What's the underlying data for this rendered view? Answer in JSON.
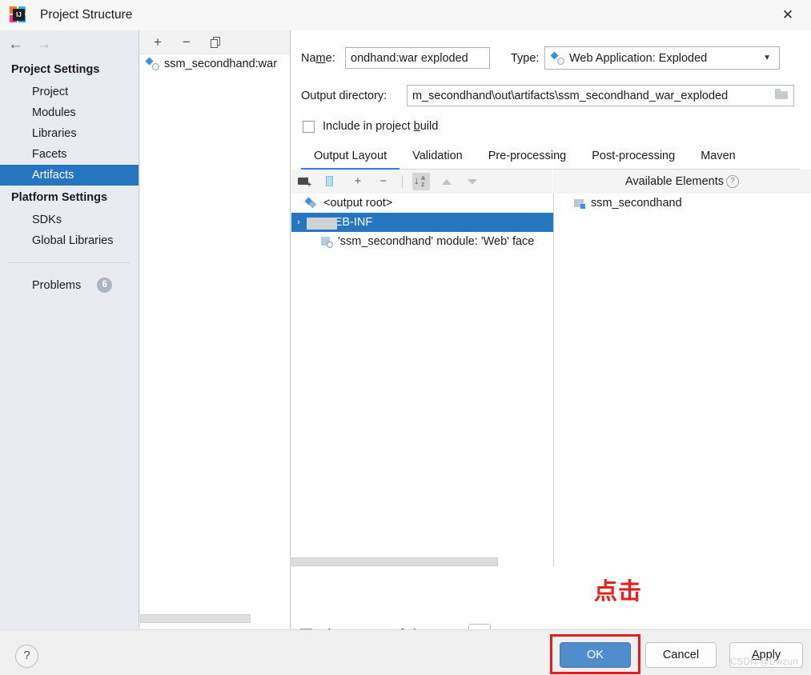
{
  "window": {
    "title": "Project Structure",
    "close_label": "✕",
    "logo_text": "IJ"
  },
  "nav": {
    "back_icon": "←",
    "forward_icon": "→"
  },
  "sidebar": {
    "sections": [
      {
        "label": "Project Settings",
        "items": [
          {
            "label": "Project",
            "selected": false
          },
          {
            "label": "Modules",
            "selected": false
          },
          {
            "label": "Libraries",
            "selected": false
          },
          {
            "label": "Facets",
            "selected": false
          },
          {
            "label": "Artifacts",
            "selected": true
          }
        ]
      },
      {
        "label": "Platform Settings",
        "items": [
          {
            "label": "SDKs",
            "selected": false
          },
          {
            "label": "Global Libraries",
            "selected": false
          }
        ]
      }
    ],
    "problems": {
      "label": "Problems",
      "count": "6"
    }
  },
  "artifact_panel": {
    "toolbar": {
      "add_label": "+",
      "remove_label": "−",
      "copy_label": "copy-icon"
    },
    "items": [
      {
        "label": "ssm_secondhand:war"
      }
    ]
  },
  "detail": {
    "name_label": "Name:",
    "name_value": "ondhand:war exploded",
    "type_label": "Type:",
    "type_value": "Web Application: Exploded",
    "type_caret": "▼",
    "output_label": "Output directory:",
    "output_value": "m_secondhand\\out\\artifacts\\ssm_secondhand_war_exploded",
    "include_label_pre": "Include in project ",
    "include_label_underlined": "b",
    "include_label_post": "uild",
    "include_checked": false,
    "tabs": [
      {
        "label": "Output Layout",
        "active": true
      },
      {
        "label": "Validation",
        "active": false
      },
      {
        "label": "Pre-processing",
        "active": false
      },
      {
        "label": "Post-processing",
        "active": false
      },
      {
        "label": "Maven",
        "active": false
      }
    ]
  },
  "layout_toolbar": {
    "add_folder_icon": "add-folder-icon",
    "add_archive_icon": "add-archive-icon",
    "add_icon": "+",
    "remove_icon": "−",
    "sort_icon": "sort-az-icon",
    "move_up_icon": "▲",
    "move_down_icon": "▼"
  },
  "available_elements": {
    "header": "Available Elements",
    "help_glyph": "?",
    "items": [
      {
        "label": "ssm_secondhand"
      }
    ]
  },
  "output_tree": {
    "rows": [
      {
        "label": "<output root>",
        "icon": "artifact-icon",
        "indent": 0,
        "expander": "",
        "selected": false
      },
      {
        "label": "WEB-INF",
        "icon": "folder-icon",
        "indent": 0,
        "expander": "›",
        "selected": true
      },
      {
        "label": "'ssm_secondhand' module: 'Web' face",
        "icon": "facet-icon",
        "indent": 1,
        "expander": "",
        "selected": false
      }
    ]
  },
  "show_content": {
    "label": "Show content of elements",
    "checked": false,
    "ellipsis_label": "..."
  },
  "footer": {
    "help_label": "?",
    "ok_label": "OK",
    "cancel_label": "Cancel",
    "apply_label_underlined": "A",
    "apply_label_rest": "pply"
  },
  "annotations": {
    "click_text": "点击",
    "watermark": "CSDN @Dwzun"
  },
  "colors": {
    "accent_blue": "#2675bf",
    "ok_button": "#4f8dcc",
    "highlight_red": "#e81b1b",
    "annotation_red": "#f01c1c"
  }
}
